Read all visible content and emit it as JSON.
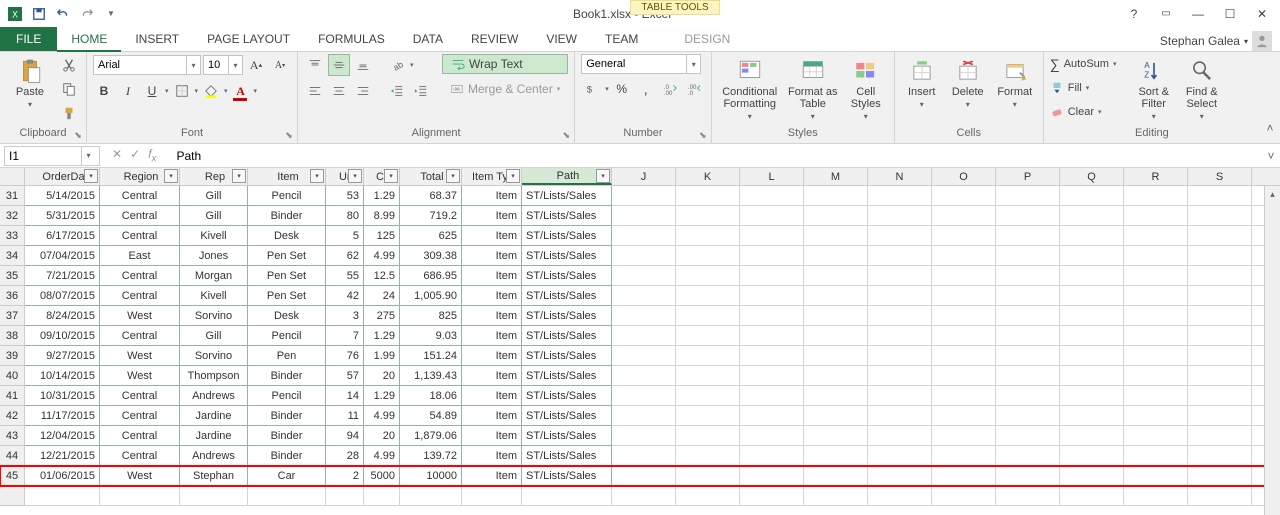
{
  "title": "Book1.xlsx - Excel",
  "context_tools": "TABLE TOOLS",
  "user": "Stephan Galea",
  "tabs": {
    "file": "FILE",
    "home": "HOME",
    "insert": "INSERT",
    "page_layout": "PAGE LAYOUT",
    "formulas": "FORMULAS",
    "data": "DATA",
    "review": "REVIEW",
    "view": "VIEW",
    "team": "TEAM",
    "design": "DESIGN"
  },
  "ribbon": {
    "clipboard": {
      "label": "Clipboard",
      "paste": "Paste"
    },
    "font": {
      "label": "Font",
      "name": "Arial",
      "size": "10",
      "bold": "B",
      "italic": "I",
      "underline": "U"
    },
    "alignment": {
      "label": "Alignment",
      "wrap_text": "Wrap Text",
      "merge_center": "Merge & Center"
    },
    "number": {
      "label": "Number",
      "format": "General"
    },
    "styles": {
      "label": "Styles",
      "cond_fmt": "Conditional Formatting",
      "fmt_table": "Format as Table",
      "cell_styles": "Cell Styles"
    },
    "cells": {
      "label": "Cells",
      "insert": "Insert",
      "delete": "Delete",
      "format": "Format"
    },
    "editing": {
      "label": "Editing",
      "autosum": "AutoSum",
      "fill": "Fill",
      "clear": "Clear",
      "sort_filter": "Sort & Filter",
      "find_select": "Find & Select"
    }
  },
  "formula_bar": {
    "cell_ref": "I1",
    "formula": "Path"
  },
  "grid": {
    "headers": [
      "OrderDa",
      "Region",
      "Rep",
      "Item",
      "Un",
      "Co",
      "Total",
      "Item Typ",
      "Path"
    ],
    "letter_cols": [
      "J",
      "K",
      "L",
      "M",
      "N",
      "O",
      "P",
      "Q",
      "R",
      "S"
    ],
    "row_start": 31,
    "rows": [
      [
        "5/14/2015",
        "Central",
        "Gill",
        "Pencil",
        "53",
        "1.29",
        "68.37",
        "Item",
        "ST/Lists/Sales"
      ],
      [
        "5/31/2015",
        "Central",
        "Gill",
        "Binder",
        "80",
        "8.99",
        "719.2",
        "Item",
        "ST/Lists/Sales"
      ],
      [
        "6/17/2015",
        "Central",
        "Kivell",
        "Desk",
        "5",
        "125",
        "625",
        "Item",
        "ST/Lists/Sales"
      ],
      [
        "07/04/2015",
        "East",
        "Jones",
        "Pen Set",
        "62",
        "4.99",
        "309.38",
        "Item",
        "ST/Lists/Sales"
      ],
      [
        "7/21/2015",
        "Central",
        "Morgan",
        "Pen Set",
        "55",
        "12.5",
        "686.95",
        "Item",
        "ST/Lists/Sales"
      ],
      [
        "08/07/2015",
        "Central",
        "Kivell",
        "Pen Set",
        "42",
        "24",
        "1,005.90",
        "Item",
        "ST/Lists/Sales"
      ],
      [
        "8/24/2015",
        "West",
        "Sorvino",
        "Desk",
        "3",
        "275",
        "825",
        "Item",
        "ST/Lists/Sales"
      ],
      [
        "09/10/2015",
        "Central",
        "Gill",
        "Pencil",
        "7",
        "1.29",
        "9.03",
        "Item",
        "ST/Lists/Sales"
      ],
      [
        "9/27/2015",
        "West",
        "Sorvino",
        "Pen",
        "76",
        "1.99",
        "151.24",
        "Item",
        "ST/Lists/Sales"
      ],
      [
        "10/14/2015",
        "West",
        "Thompson",
        "Binder",
        "57",
        "20",
        "1,139.43",
        "Item",
        "ST/Lists/Sales"
      ],
      [
        "10/31/2015",
        "Central",
        "Andrews",
        "Pencil",
        "14",
        "1.29",
        "18.06",
        "Item",
        "ST/Lists/Sales"
      ],
      [
        "11/17/2015",
        "Central",
        "Jardine",
        "Binder",
        "11",
        "4.99",
        "54.89",
        "Item",
        "ST/Lists/Sales"
      ],
      [
        "12/04/2015",
        "Central",
        "Jardine",
        "Binder",
        "94",
        "20",
        "1,879.06",
        "Item",
        "ST/Lists/Sales"
      ],
      [
        "12/21/2015",
        "Central",
        "Andrews",
        "Binder",
        "28",
        "4.99",
        "139.72",
        "Item",
        "ST/Lists/Sales"
      ],
      [
        "01/06/2015",
        "West",
        "Stephan",
        "Car",
        "2",
        "5000",
        "10000",
        "Item",
        "ST/Lists/Sales"
      ]
    ],
    "highlight_row_index": 14
  }
}
